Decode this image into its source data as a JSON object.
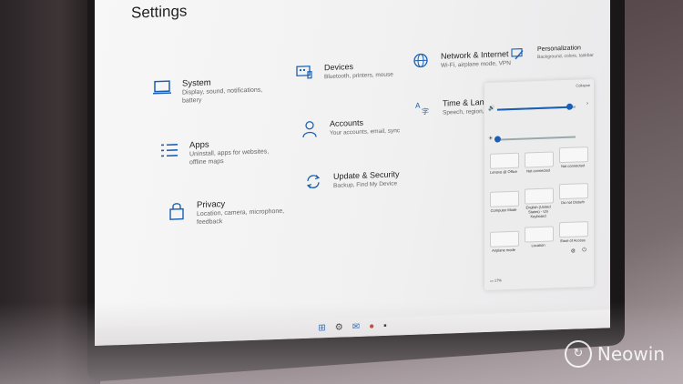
{
  "window": {
    "title": "Settings"
  },
  "categories": [
    {
      "name": "System",
      "desc": "Display, sound, notifications, battery",
      "icon": "laptop-icon"
    },
    {
      "name": "Devices",
      "desc": "Bluetooth, printers, mouse",
      "icon": "devices-icon"
    },
    {
      "name": "Network & Internet",
      "desc": "Wi-Fi, airplane mode, VPN",
      "icon": "globe-icon"
    },
    {
      "name": "Personalization",
      "desc": "Background, colors, taskbar",
      "icon": "brush-icon"
    },
    {
      "name": "Apps",
      "desc": "Uninstall, apps for websites, offline maps",
      "icon": "apps-list-icon"
    },
    {
      "name": "Accounts",
      "desc": "Your accounts, email, sync",
      "icon": "person-icon"
    },
    {
      "name": "Time & Language",
      "desc": "Speech, region, keyboard",
      "icon": "time-language-icon"
    },
    {
      "name": "Privacy",
      "desc": "Location, camera, microphone, feedback",
      "icon": "lock-icon"
    },
    {
      "name": "Update & Security",
      "desc": "Backup, Find My Device",
      "icon": "sync-icon"
    }
  ],
  "quick_settings": {
    "collapse_label": "Collapse",
    "volume_level": 0.92,
    "brightness_level": 0.0,
    "tiles": [
      {
        "label": "Lenovo @ Office"
      },
      {
        "label": "Not connected"
      },
      {
        "label": "Not connected"
      },
      {
        "label": "Computer Mode"
      },
      {
        "label": "English (United States) - US Keyboard"
      },
      {
        "label": "Do not Disturb"
      },
      {
        "label": "Airplane mode"
      },
      {
        "label": "Location"
      },
      {
        "label": "Ease of Access"
      }
    ],
    "battery": "17%"
  },
  "taskbar": {
    "icons": [
      "windows-start-icon",
      "settings-icon",
      "mail-icon",
      "office-icon",
      "terminal-icon"
    ]
  },
  "watermark": {
    "text": "Neowin"
  },
  "colors": {
    "accent": "#1a5fb4"
  }
}
